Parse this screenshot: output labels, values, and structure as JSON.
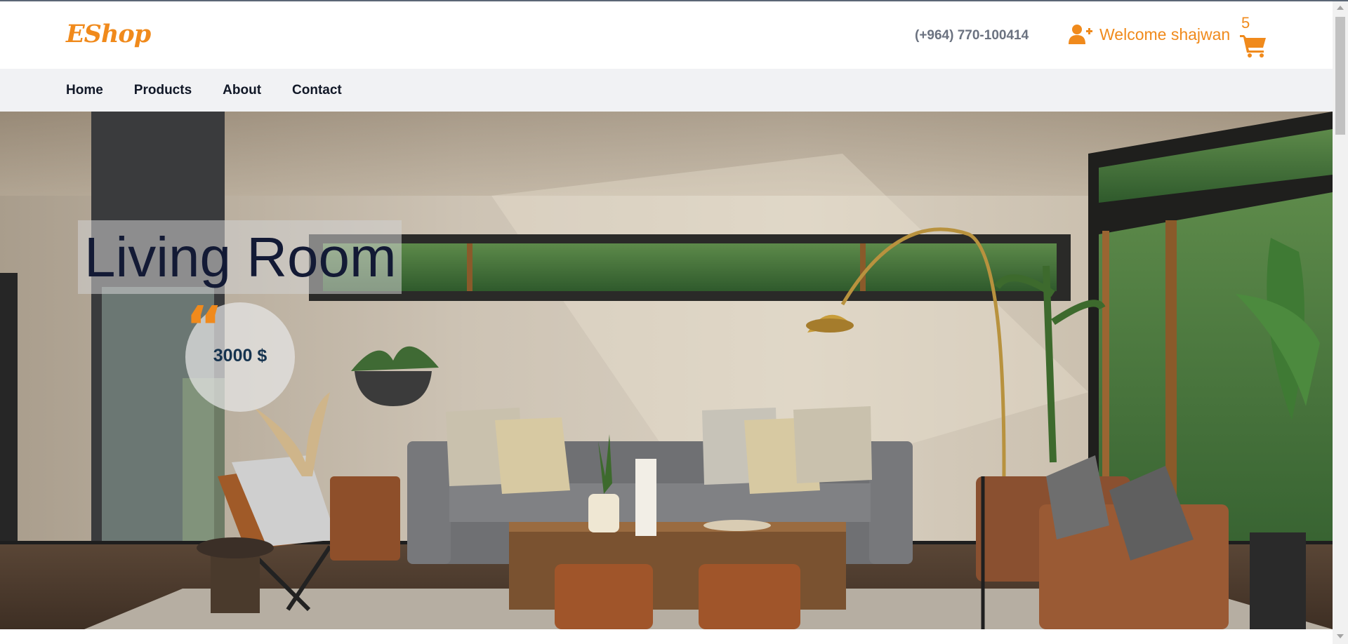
{
  "header": {
    "logo": "EShop",
    "phone": "(+964) 770-100414",
    "welcome": "Welcome shajwan",
    "user_icon": "user-plus-icon",
    "cart_icon": "shopping-cart-icon",
    "cart_count": "5"
  },
  "nav": {
    "items": [
      "Home",
      "Products",
      "About",
      "Contact"
    ]
  },
  "hero": {
    "title": "Living Room",
    "quote_icon": "quote-icon",
    "price": "3000 $"
  },
  "colors": {
    "accent": "#f08a1c",
    "nav_background": "#f1f2f4",
    "title_text": "#131a35",
    "price_text": "#15334f"
  }
}
